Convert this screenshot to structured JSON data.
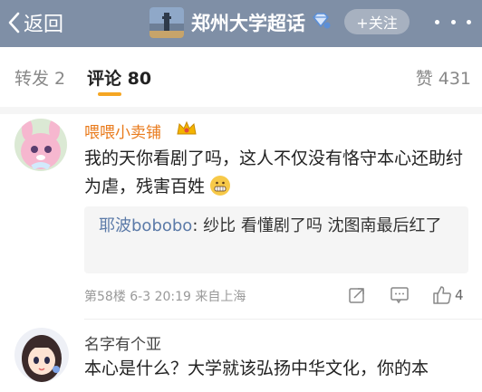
{
  "header": {
    "back_label": "返回",
    "title": "郑州大学超话",
    "follow_label": "+关注"
  },
  "tabs": {
    "forward": "转发 2",
    "comments": "评论 80",
    "likes": "赞 431"
  },
  "comments": [
    {
      "username": "喂喂小卖铺",
      "text": "我的天你看剧了吗，这人不仅没有恪守本心还助纣为虐，残害百姓",
      "reply": {
        "user": "耶波bobobo",
        "text": ": 纱比 看懂剧了吗 沈图南最后红了"
      },
      "meta": "第58楼 6-3 20:19 来自上海",
      "like_count": "4"
    },
    {
      "username": "名字有个亚",
      "text": "本心是什么？大学就该弘扬中华文化，你的本"
    }
  ],
  "colors": {
    "header_bg": "#7f8fa6",
    "username_orange": "#e97a1b",
    "reply_user_blue": "#5b7aa8",
    "tab_accent": "#f5a623"
  }
}
